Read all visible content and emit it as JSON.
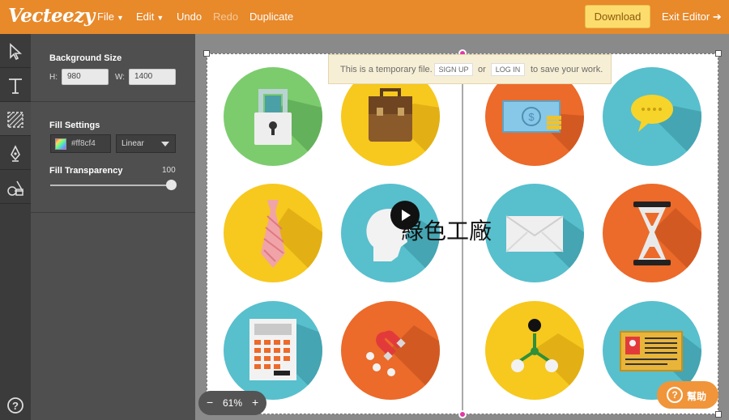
{
  "topbar": {
    "logo": "Vecteezy",
    "menu": {
      "file": "File",
      "edit": "Edit",
      "undo": "Undo",
      "redo": "Redo",
      "duplicate": "Duplicate"
    },
    "download": "Download",
    "exit_editor": "Exit Editor"
  },
  "tools": [
    "pointer-icon",
    "text-icon",
    "pattern-icon",
    "pen-icon",
    "shapes-icon",
    "help-icon"
  ],
  "panel": {
    "background_size": {
      "title": "Background Size",
      "h_label": "H:",
      "h_value": "980",
      "w_label": "W:",
      "w_value": "1400"
    },
    "fill": {
      "title": "Fill Settings",
      "color": "#ff8cf4",
      "gradient_type": "Linear",
      "transparency_label": "Fill Transparency",
      "transparency_value": "100",
      "transparency_fraction": 1.0
    }
  },
  "banner": {
    "text1": "This is a temporary file.",
    "signup": "SIGN UP",
    "or": "or",
    "login": "LOG IN",
    "text2": "to save your work."
  },
  "overlay_text": "綠色工廠",
  "zoom": {
    "minus": "−",
    "value": "61%",
    "plus": "+"
  },
  "help_button": {
    "icon": "?",
    "label": "幫助"
  },
  "colors": {
    "brand_orange": "#e8892a",
    "download_yellow": "#fcdc6c",
    "green": "#7ccc6e",
    "yellow": "#f7c81e",
    "orange": "#ec6a2a",
    "teal": "#58bfcd"
  }
}
